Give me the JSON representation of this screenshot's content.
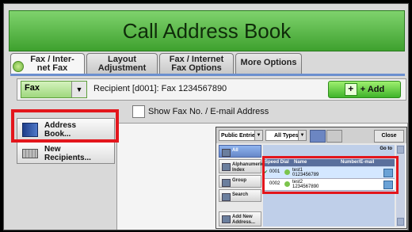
{
  "header": {
    "title": "Call Address Book"
  },
  "tabs": [
    {
      "label": "Fax / Inter-\nnet Fax",
      "line1": "Fax / Inter-",
      "line2": "net Fax"
    },
    {
      "line1": "Layout",
      "line2": "Adjustment"
    },
    {
      "line1": "Fax / Internet",
      "line2": "Fax Options"
    },
    {
      "line1": "More Options",
      "line2": ""
    }
  ],
  "recipient_row": {
    "fax_mode": "Fax",
    "recipient_text": "Recipient [d001]: Fax 1234567890",
    "add_label": "+ Add"
  },
  "show_fax_label": "Show Fax No. / E-mail Address",
  "left_buttons": [
    {
      "line1": "Address",
      "line2": "Book..."
    },
    {
      "line1": "New",
      "line2": "Recipients..."
    }
  ],
  "inset": {
    "entries_select": "Public Entries",
    "types_select": "All Types",
    "close_label": "Close",
    "goto_line1": "Go to",
    "nav": [
      {
        "line1": "All",
        "line2": ""
      },
      {
        "line1": "Alphanumeric",
        "line2": "Index"
      },
      {
        "line1": "Group",
        "line2": ""
      },
      {
        "line1": "Search",
        "line2": ""
      },
      {
        "line1": "Add New",
        "line2": "Address..."
      }
    ],
    "columns": [
      "Speed Dial",
      "Name",
      "Number/E-mail"
    ],
    "rows": [
      {
        "speed_dial": "0001",
        "name": "test1",
        "number": "0123456789",
        "checked": true
      },
      {
        "speed_dial": "0002",
        "name": "test2",
        "number": "1234567890",
        "checked": false
      }
    ]
  },
  "colors": {
    "title_green": "#4fb33b",
    "highlight_red": "#e3161c"
  }
}
